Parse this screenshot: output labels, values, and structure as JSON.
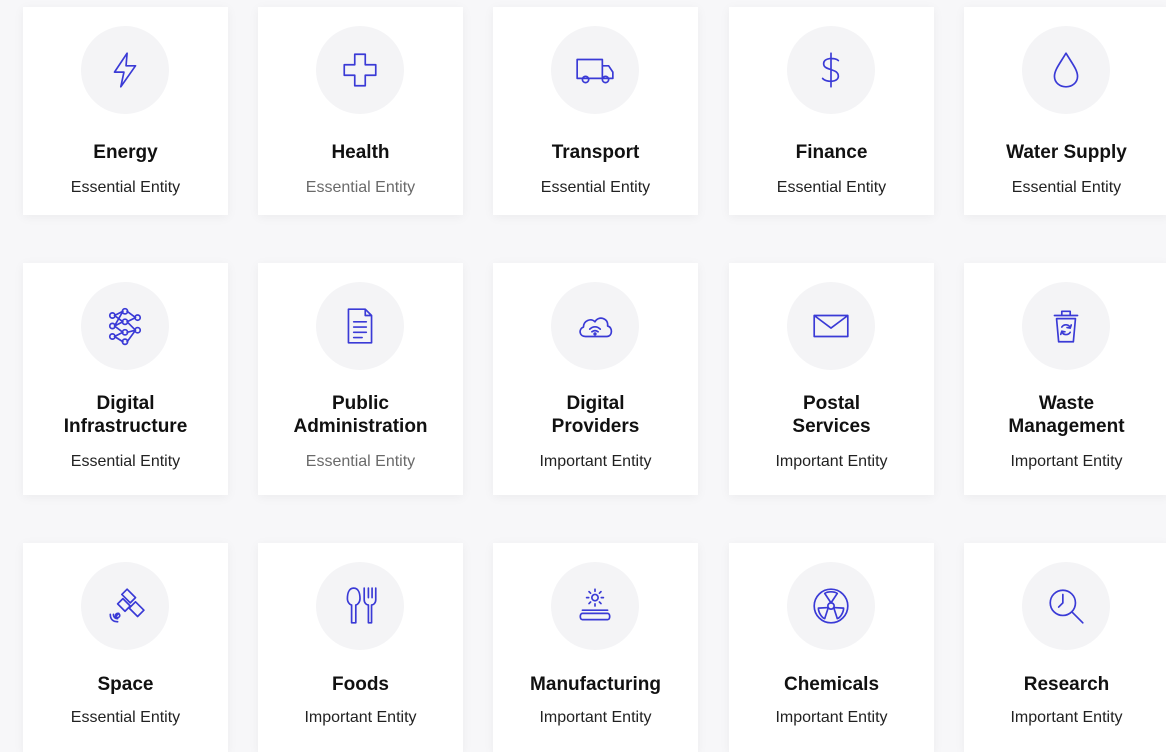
{
  "sectors": [
    {
      "title": "Energy",
      "subtitle": "Essential Entity",
      "icon": "lightning-icon"
    },
    {
      "title": "Health",
      "subtitle": "Essential Entity",
      "icon": "medical-cross-icon"
    },
    {
      "title": "Transport",
      "subtitle": "Essential Entity",
      "icon": "truck-icon"
    },
    {
      "title": "Finance",
      "subtitle": "Essential Entity",
      "icon": "dollar-icon"
    },
    {
      "title": "Water Supply",
      "subtitle": "Essential Entity",
      "icon": "water-drop-icon"
    },
    {
      "title": "Digital Infrastructure",
      "title_line1": "Digital",
      "title_line2": "Infrastructure",
      "subtitle": "Essential Entity",
      "icon": "network-icon"
    },
    {
      "title": "Public Administration",
      "title_line1": "Public",
      "title_line2": "Administration",
      "subtitle": "Essential Entity",
      "icon": "document-icon"
    },
    {
      "title": "Digital Providers",
      "title_line1": "Digital",
      "title_line2": "Providers",
      "subtitle": "Important Entity",
      "icon": "cloud-wifi-icon"
    },
    {
      "title": "Postal Services",
      "title_line1": "Postal",
      "title_line2": "Services",
      "subtitle": "Important Entity",
      "icon": "envelope-icon"
    },
    {
      "title": "Waste Management",
      "title_line1": "Waste",
      "title_line2": "Management",
      "subtitle": "Important Entity",
      "icon": "recycle-bin-icon"
    },
    {
      "title": "Space",
      "subtitle": "Essential Entity",
      "icon": "satellite-icon"
    },
    {
      "title": "Foods",
      "subtitle": "Important Entity",
      "icon": "spoon-fork-icon"
    },
    {
      "title": "Manufacturing",
      "subtitle": "Important Entity",
      "icon": "gear-conveyor-icon"
    },
    {
      "title": "Chemicals",
      "subtitle": "Important Entity",
      "icon": "radiation-icon"
    },
    {
      "title": "Research",
      "subtitle": "Important Entity",
      "icon": "magnifier-icon"
    }
  ],
  "colors": {
    "icon_stroke": "#3a3ad6",
    "icon_circle_bg": "#f4f4f6",
    "page_bg": "#f7f7f9",
    "card_bg": "#ffffff",
    "title_text": "#111111",
    "subtitle_text": "#222222",
    "subtitle_muted": "#6a6a6a"
  }
}
